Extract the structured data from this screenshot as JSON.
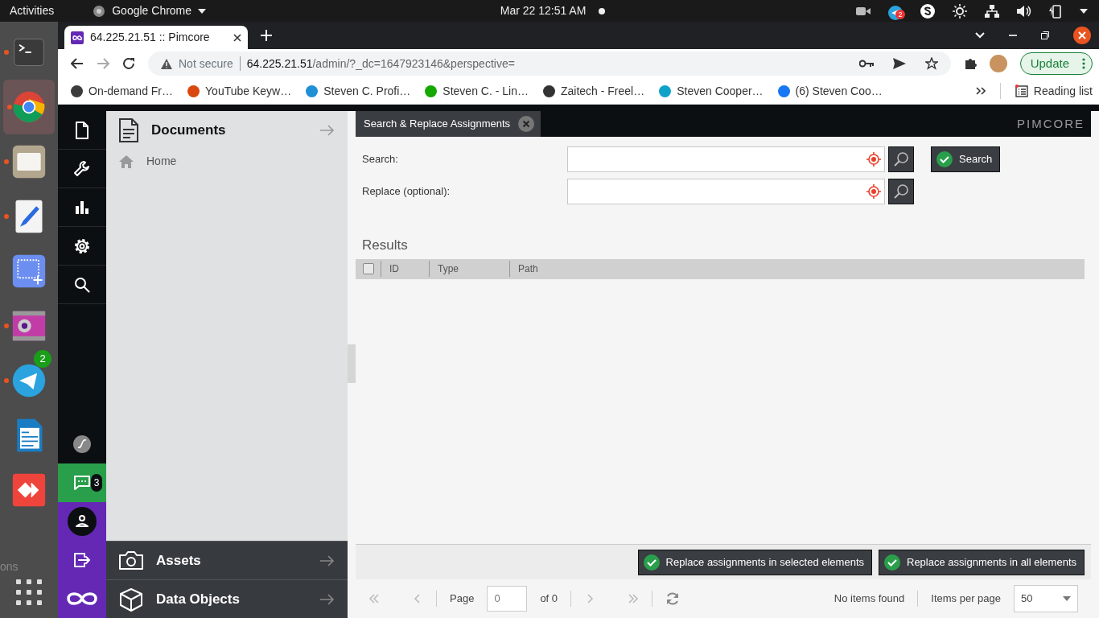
{
  "system_bar": {
    "activities": "Activities",
    "app": "Google Chrome",
    "clock": "Mar 22  12:51 AM",
    "tray_badge": "2"
  },
  "dock": {
    "items": [
      {
        "kind": "terminal",
        "running": true,
        "selected": false
      },
      {
        "kind": "chrome",
        "running": true,
        "selected": true
      },
      {
        "kind": "files",
        "running": true,
        "selected": false
      },
      {
        "kind": "editor",
        "running": true,
        "selected": false
      },
      {
        "kind": "screenshot",
        "running": false,
        "selected": false
      },
      {
        "kind": "camera",
        "running": true,
        "selected": false
      },
      {
        "kind": "telegram",
        "running": true,
        "selected": false,
        "badge": "2"
      },
      {
        "kind": "writer",
        "running": false,
        "selected": false
      },
      {
        "kind": "remote",
        "running": false,
        "selected": false
      }
    ],
    "background_fragment": "ons"
  },
  "browser": {
    "tab": {
      "title": "64.225.21.51 :: Pimcore"
    },
    "address": {
      "security": "Not secure",
      "host": "64.225.21.51",
      "path": "/admin/?_dc=1647923146&perspective="
    },
    "update_button": "Update",
    "bookmarks": [
      {
        "label": "On-demand Fr…",
        "color": "#3c3c3c"
      },
      {
        "label": "YouTube Keyw…",
        "color": "#d9480f"
      },
      {
        "label": "Steven C. Profi…",
        "color": "#1f8fd6"
      },
      {
        "label": "Steven C. - Lin…",
        "color": "#14a800"
      },
      {
        "label": "Zaitech - Freel…",
        "color": "#333333"
      },
      {
        "label": "Steven Cooper…",
        "color": "#0fa2c9"
      },
      {
        "label": "(6) Steven Coo…",
        "color": "#1877f2"
      }
    ],
    "reading_list": "Reading list"
  },
  "pimcore": {
    "nav": [
      {
        "kind": "documents"
      },
      {
        "kind": "tools"
      },
      {
        "kind": "marketing"
      },
      {
        "kind": "settings"
      },
      {
        "kind": "search"
      }
    ],
    "chat_badge": "3",
    "tree": {
      "title": "Documents",
      "items": [
        {
          "label": "Home"
        }
      ]
    },
    "bottom_panels": [
      {
        "kind": "assets",
        "title": "Assets"
      },
      {
        "kind": "objects",
        "title": "Data Objects"
      }
    ],
    "tabs": [
      {
        "label": "Search & Replace Assignments",
        "selected": true
      }
    ],
    "brand": "PIMCORE",
    "form": {
      "fields": [
        {
          "label": "Search:"
        },
        {
          "label": "Replace (optional):"
        }
      ],
      "search_button": "Search"
    },
    "results": {
      "title": "Results",
      "select_all_checked": false,
      "columns": [
        "ID",
        "Type",
        "Path"
      ]
    },
    "actions": [
      "Replace assignments in selected elements",
      "Replace assignments in all elements"
    ],
    "paging": {
      "page_label": "Page",
      "page_value": "0",
      "of": "of 0",
      "status": "No items found",
      "per_page_label": "Items per page",
      "per_page": "50"
    }
  }
}
